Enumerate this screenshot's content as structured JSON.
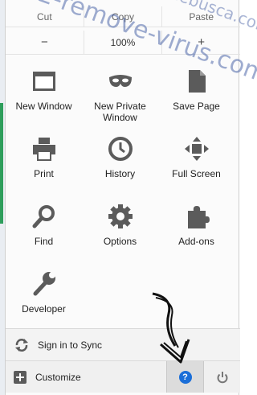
{
  "edit": {
    "cut": "Cut",
    "copy": "Copy",
    "paste": "Paste"
  },
  "zoom": {
    "minus": "−",
    "value": "100%",
    "plus": "+"
  },
  "items": [
    {
      "label": "New Window",
      "icon": "window-icon"
    },
    {
      "label": "New Private Window",
      "icon": "mask-icon"
    },
    {
      "label": "Save Page",
      "icon": "page-icon"
    },
    {
      "label": "Print",
      "icon": "printer-icon"
    },
    {
      "label": "History",
      "icon": "clock-icon"
    },
    {
      "label": "Full Screen",
      "icon": "fullscreen-icon"
    },
    {
      "label": "Find",
      "icon": "magnifier-icon"
    },
    {
      "label": "Options",
      "icon": "gear-icon"
    },
    {
      "label": "Add-ons",
      "icon": "puzzle-icon"
    },
    {
      "label": "Developer",
      "icon": "wrench-icon"
    }
  ],
  "sync": {
    "label": "Sign in to Sync"
  },
  "footer": {
    "customize": "Customize",
    "help": "?"
  },
  "watermark": {
    "main": "2-remove-virus.com",
    "top": "Onlinebusca.com"
  },
  "colors": {
    "icon": "#5b5b5b",
    "help": "#1a6ed8",
    "watermark": "#2846a0"
  }
}
